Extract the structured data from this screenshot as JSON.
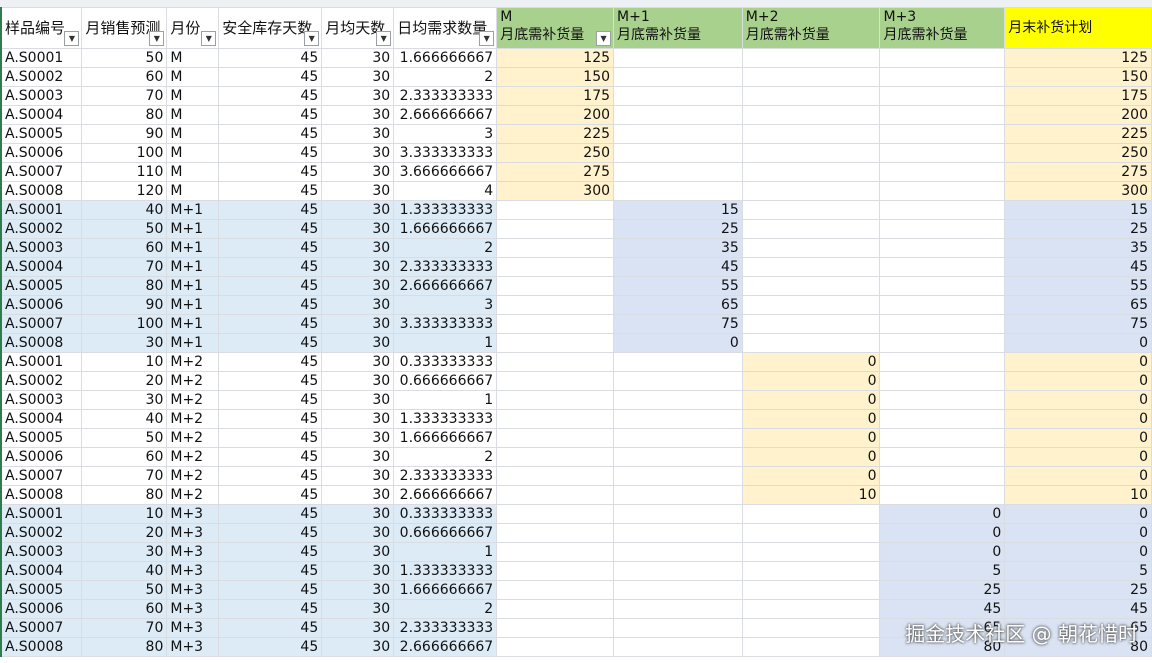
{
  "headers": {
    "sample_id": "样品编号",
    "forecast": "月销售预测",
    "month": "月份",
    "safety_days": "安全库存天数",
    "month_days": "月均天数",
    "daily_demand": "日均需求数量",
    "m_label": "M",
    "m1_label": "M+1",
    "m2_label": "M+2",
    "m3_label": "M+3",
    "replenish_label": "月底需补货量",
    "plan": "月末补货计划"
  },
  "rows": [
    [
      "A.S0001",
      "50",
      "M",
      "45",
      "30",
      "1.666666667",
      "125",
      "",
      "",
      "",
      "125"
    ],
    [
      "A.S0002",
      "60",
      "M",
      "45",
      "30",
      "2",
      "150",
      "",
      "",
      "",
      "150"
    ],
    [
      "A.S0003",
      "70",
      "M",
      "45",
      "30",
      "2.333333333",
      "175",
      "",
      "",
      "",
      "175"
    ],
    [
      "A.S0004",
      "80",
      "M",
      "45",
      "30",
      "2.666666667",
      "200",
      "",
      "",
      "",
      "200"
    ],
    [
      "A.S0005",
      "90",
      "M",
      "45",
      "30",
      "3",
      "225",
      "",
      "",
      "",
      "225"
    ],
    [
      "A.S0006",
      "100",
      "M",
      "45",
      "30",
      "3.333333333",
      "250",
      "",
      "",
      "",
      "250"
    ],
    [
      "A.S0007",
      "110",
      "M",
      "45",
      "30",
      "3.666666667",
      "275",
      "",
      "",
      "",
      "275"
    ],
    [
      "A.S0008",
      "120",
      "M",
      "45",
      "30",
      "4",
      "300",
      "",
      "",
      "",
      "300"
    ],
    [
      "A.S0001",
      "40",
      "M+1",
      "45",
      "30",
      "1.333333333",
      "",
      "15",
      "",
      "",
      "15"
    ],
    [
      "A.S0002",
      "50",
      "M+1",
      "45",
      "30",
      "1.666666667",
      "",
      "25",
      "",
      "",
      "25"
    ],
    [
      "A.S0003",
      "60",
      "M+1",
      "45",
      "30",
      "2",
      "",
      "35",
      "",
      "",
      "35"
    ],
    [
      "A.S0004",
      "70",
      "M+1",
      "45",
      "30",
      "2.333333333",
      "",
      "45",
      "",
      "",
      "45"
    ],
    [
      "A.S0005",
      "80",
      "M+1",
      "45",
      "30",
      "2.666666667",
      "",
      "55",
      "",
      "",
      "55"
    ],
    [
      "A.S0006",
      "90",
      "M+1",
      "45",
      "30",
      "3",
      "",
      "65",
      "",
      "",
      "65"
    ],
    [
      "A.S0007",
      "100",
      "M+1",
      "45",
      "30",
      "3.333333333",
      "",
      "75",
      "",
      "",
      "75"
    ],
    [
      "A.S0008",
      "30",
      "M+1",
      "45",
      "30",
      "1",
      "",
      "0",
      "",
      "",
      "0"
    ],
    [
      "A.S0001",
      "10",
      "M+2",
      "45",
      "30",
      "0.333333333",
      "",
      "",
      "0",
      "",
      "0"
    ],
    [
      "A.S0002",
      "20",
      "M+2",
      "45",
      "30",
      "0.666666667",
      "",
      "",
      "0",
      "",
      "0"
    ],
    [
      "A.S0003",
      "30",
      "M+2",
      "45",
      "30",
      "1",
      "",
      "",
      "0",
      "",
      "0"
    ],
    [
      "A.S0004",
      "40",
      "M+2",
      "45",
      "30",
      "1.333333333",
      "",
      "",
      "0",
      "",
      "0"
    ],
    [
      "A.S0005",
      "50",
      "M+2",
      "45",
      "30",
      "1.666666667",
      "",
      "",
      "0",
      "",
      "0"
    ],
    [
      "A.S0006",
      "60",
      "M+2",
      "45",
      "30",
      "2",
      "",
      "",
      "0",
      "",
      "0"
    ],
    [
      "A.S0007",
      "70",
      "M+2",
      "45",
      "30",
      "2.333333333",
      "",
      "",
      "0",
      "",
      "0"
    ],
    [
      "A.S0008",
      "80",
      "M+2",
      "45",
      "30",
      "2.666666667",
      "",
      "",
      "10",
      "",
      "10"
    ],
    [
      "A.S0001",
      "10",
      "M+3",
      "45",
      "30",
      "0.333333333",
      "",
      "",
      "",
      "0",
      "0"
    ],
    [
      "A.S0002",
      "20",
      "M+3",
      "45",
      "30",
      "0.666666667",
      "",
      "",
      "",
      "0",
      "0"
    ],
    [
      "A.S0003",
      "30",
      "M+3",
      "45",
      "30",
      "1",
      "",
      "",
      "",
      "0",
      "0"
    ],
    [
      "A.S0004",
      "40",
      "M+3",
      "45",
      "30",
      "1.333333333",
      "",
      "",
      "",
      "5",
      "5"
    ],
    [
      "A.S0005",
      "50",
      "M+3",
      "45",
      "30",
      "1.666666667",
      "",
      "",
      "",
      "25",
      "25"
    ],
    [
      "A.S0006",
      "60",
      "M+3",
      "45",
      "30",
      "2",
      "",
      "",
      "",
      "45",
      "45"
    ],
    [
      "A.S0007",
      "70",
      "M+3",
      "45",
      "30",
      "2.333333333",
      "",
      "",
      "",
      "65",
      "65"
    ],
    [
      "A.S0008",
      "80",
      "M+3",
      "45",
      "30",
      "2.666666667",
      "",
      "",
      "",
      "80",
      "80"
    ]
  ],
  "watermark": "掘金技术社区 @ 朝花惜时",
  "colors": {
    "header_green": "#a9d18e",
    "header_yellow": "#ffff00",
    "band_blue": "#ddebf7",
    "cell_yellow": "#fff2cc",
    "cell_steel": "#dae3f3"
  }
}
